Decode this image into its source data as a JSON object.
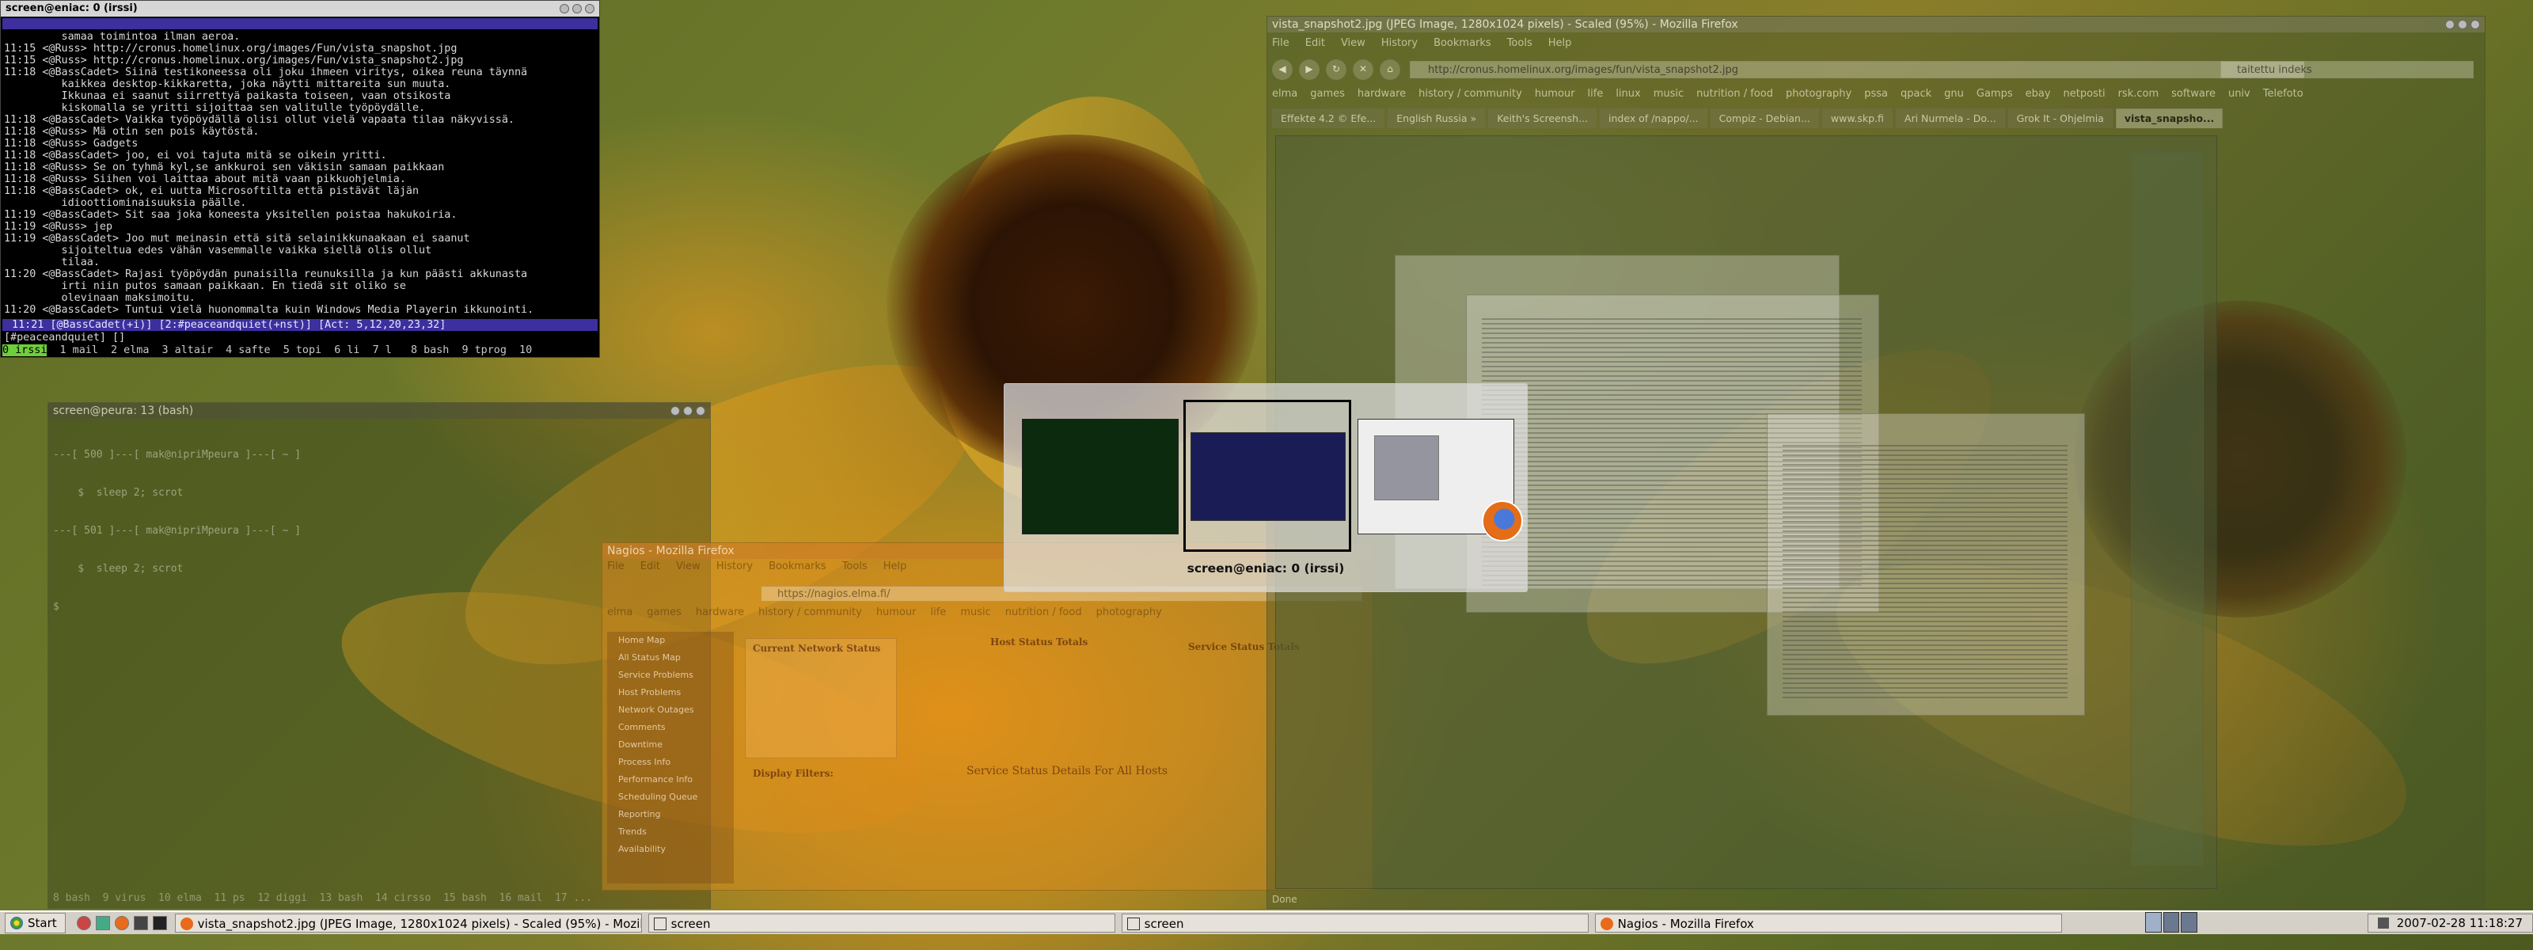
{
  "irssi": {
    "title": "screen@eniac: 0 (irssi)",
    "log": [
      {
        "ts": "",
        "nick": "",
        "text": "         samaa toimintoa ilman aeroa."
      },
      {
        "ts": "11:15",
        "nick": "<@Russ>",
        "text": " http://cronus.homelinux.org/images/Fun/vista_snapshot.jpg"
      },
      {
        "ts": "11:15",
        "nick": "<@Russ>",
        "text": " http://cronus.homelinux.org/images/Fun/vista_snapshot2.jpg"
      },
      {
        "ts": "11:18",
        "nick": "<@BassCadet>",
        "text": " Siinä testikoneessa oli joku ihmeen viritys, oikea reuna täynnä"
      },
      {
        "ts": "",
        "nick": "",
        "text": "         kaikkea desktop-kikkaretta, joka näytti mittareita sun muuta."
      },
      {
        "ts": "",
        "nick": "",
        "text": "         Ikkunaa ei saanut siirrettyä paikasta toiseen, vaan otsikosta"
      },
      {
        "ts": "",
        "nick": "",
        "text": "         kiskomalla se yritti sijoittaa sen valitulle työpöydälle."
      },
      {
        "ts": "11:18",
        "nick": "<@BassCadet>",
        "text": " Vaikka työpöydällä olisi ollut vielä vapaata tilaa näkyvissä."
      },
      {
        "ts": "11:18",
        "nick": "<@Russ>",
        "text": " Mä otin sen pois käytöstä."
      },
      {
        "ts": "11:18",
        "nick": "<@Russ>",
        "text": " Gadgets"
      },
      {
        "ts": "11:18",
        "nick": "<@BassCadet>",
        "text": " joo, ei voi tajuta mitä se oikein yritti."
      },
      {
        "ts": "11:18",
        "nick": "<@Russ>",
        "text": " Se on tyhmä kyl,se ankkuroi sen väkisin samaan paikkaan"
      },
      {
        "ts": "11:18",
        "nick": "<@Russ>",
        "text": " Siihen voi laittaa about mitä vaan pikkuohjelmia."
      },
      {
        "ts": "11:18",
        "nick": "<@BassCadet>",
        "text": " ok, ei uutta Microsoftilta että pistävät läjän"
      },
      {
        "ts": "",
        "nick": "",
        "text": "         idioottiominaisuuksia päälle."
      },
      {
        "ts": "11:19",
        "nick": "<@BassCadet>",
        "text": " Sit saa joka koneesta yksitellen poistaa hakukoiria."
      },
      {
        "ts": "11:19",
        "nick": "<@Russ>",
        "text": " jep"
      },
      {
        "ts": "11:19",
        "nick": "<@BassCadet>",
        "text": " Joo mut meinasin että sitä selainikkunaakaan ei saanut"
      },
      {
        "ts": "",
        "nick": "",
        "text": "         sijoiteltua edes vähän vasemmalle vaikka siellä olis ollut"
      },
      {
        "ts": "",
        "nick": "",
        "text": "         tilaa."
      },
      {
        "ts": "11:20",
        "nick": "<@BassCadet>",
        "text": " Rajasi työpöydän punaisilla reunuksilla ja kun päästi akkunasta"
      },
      {
        "ts": "",
        "nick": "",
        "text": "         irti niin putos samaan paikkaan. En tiedä sit oliko se"
      },
      {
        "ts": "",
        "nick": "",
        "text": "         olevinaan maksimoitu."
      },
      {
        "ts": "11:20",
        "nick": "<@BassCadet>",
        "text": " Tuntui vielä huonommalta kuin Windows Media Playerin ikkunointi."
      }
    ],
    "statusbar": " 11:21 [@BassCadet(+i)] [2:#peaceandquiet(+nst)] [Act: 5,12,20,23,32]",
    "input": "[#peaceandquiet] []",
    "screen_active": "0 irssi",
    "screen_rest": "  1 mail  2 elma  3 altair  4 safte  5 topi  6 li  7 l   8 bash  9 tprog  10"
  },
  "bash": {
    "title": "screen@peura: 13 (bash)",
    "log": [
      "---[ 500 ]---[ mak@nipriMpeura ]---[ ~ ]",
      "    $  sleep 2; scrot",
      "---[ 501 ]---[ mak@nipriMpeura ]---[ ~ ]",
      "    $  sleep 2; scrot",
      "$ "
    ],
    "bar": "8 bash  9 virus  10 elma  11 ps  12 diggi  13 bash  14 cirsso  15 bash  16 mail  17 ..."
  },
  "nagios": {
    "title": "Nagios - Mozilla Firefox",
    "menu": [
      "File",
      "Edit",
      "View",
      "History",
      "Bookmarks",
      "Tools",
      "Help"
    ],
    "url": "https://nagios.elma.fi/",
    "bookmarks": [
      "elma",
      "games",
      "hardware",
      "history / community",
      "humour",
      "life",
      "music",
      "nutrition / food",
      "photography"
    ],
    "side": [
      "Home Map",
      "All Status Map",
      "Service Problems",
      "Host Problems",
      "Network Outages",
      "Comments",
      "Downtime",
      "Process Info",
      "Performance Info",
      "Scheduling Queue",
      "Reporting",
      "Trends",
      "Availability"
    ],
    "status_title": "Current Network Status",
    "host_totals": "Host Status Totals",
    "service_totals": "Service Status Totals",
    "details_title": "Service Status Details For All Hosts",
    "filters_title": "Display Filters:"
  },
  "firefox": {
    "title": "vista_snapshot2.jpg (JPEG Image, 1280x1024 pixels) - Scaled (95%) - Mozilla Firefox",
    "menu": [
      "File",
      "Edit",
      "View",
      "History",
      "Bookmarks",
      "Tools",
      "Help"
    ],
    "url": "http://cronus.homelinux.org/images/fun/vista_snapshot2.jpg",
    "search": "taitettu indeks",
    "bookmarks": [
      "elma",
      "games",
      "hardware",
      "history / community",
      "humour",
      "life",
      "linux",
      "music",
      "nutrition / food",
      "photography",
      "pssa",
      "qpack",
      "gnu",
      "Gamps",
      "ebay",
      "netposti",
      "rsk.com",
      "software",
      "univ",
      "Telefoto"
    ],
    "tabs": [
      "Effekte 4.2 © Efe...",
      "English Russia »",
      "Keith's Screensh...",
      "index of /nappo/...",
      "Compiz - Debian...",
      "www.skp.fi",
      "Ari Nurmela - Do...",
      "Grok It - Ohjelmia",
      "vista_snapsho..."
    ],
    "status": "Done"
  },
  "switcher": {
    "label": "screen@eniac: 0 (irssi)"
  },
  "taskbar": {
    "start": "Start",
    "tasks": [
      "vista_snapshot2.jpg (JPEG Image, 1280x1024 pixels) - Scaled (95%) - Mozilla Firefox",
      "screen",
      "screen",
      "Nagios - Mozilla Firefox"
    ],
    "clock": "2007-02-28 11:18:27"
  }
}
